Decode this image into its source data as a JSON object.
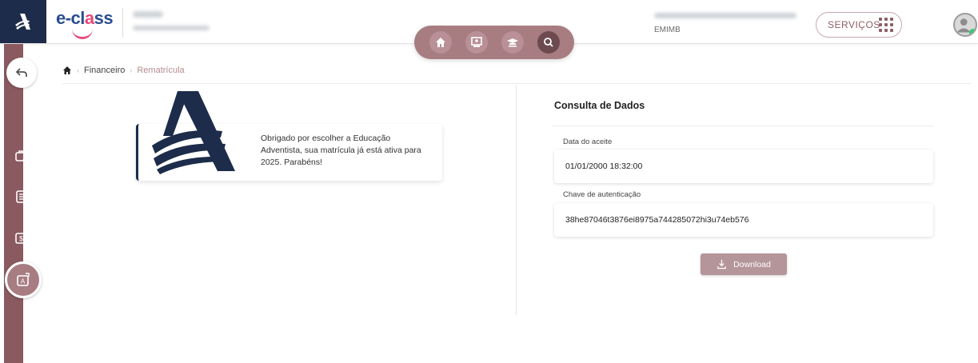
{
  "header": {
    "app_logo_text_a": "e-cl",
    "app_logo_text_b": "a",
    "app_logo_text_c": "ss",
    "user_code": "EMIMB",
    "services_label": "SERVIÇOS"
  },
  "nav_icons": [
    "home-icon",
    "person-board-icon",
    "graduation-cap-icon",
    "search-icon"
  ],
  "sidebar_icons": [
    "back-arrow-icon",
    "briefcase-clock-icon",
    "receipt-icon",
    "money-exchange-icon",
    "rematricula-icon"
  ],
  "breadcrumb": {
    "items": [
      "Financeiro",
      "Rematrícula"
    ]
  },
  "thanks": {
    "message": "Obrigado por escolher a Educação Adventista, sua matrícula já está ativa para 2025. Parabéns!"
  },
  "panel": {
    "title": "Consulta de Dados",
    "fields": [
      {
        "label": "Data do aceite",
        "value": "01/01/2000  18:32:00"
      },
      {
        "label": "Chave de autenticação",
        "value": "38he87046t3876ei8975a744285072hi3u74eb576"
      }
    ],
    "download_label": "Download"
  },
  "colors": {
    "brand_navy": "#1c2c4a",
    "accent_rose": "#a77d82",
    "sidebar_bg": "#8a5a60"
  }
}
